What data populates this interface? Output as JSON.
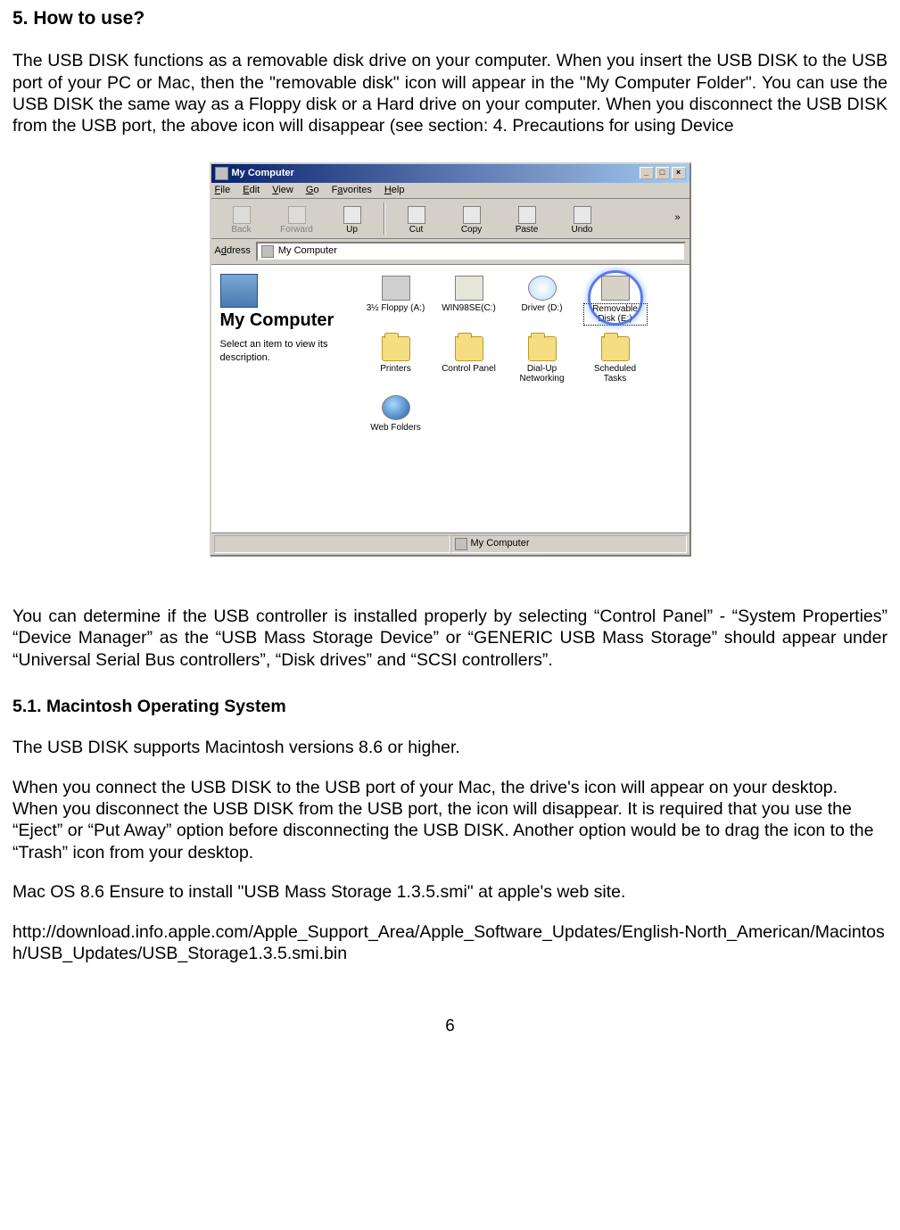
{
  "heading": "5. How to use?",
  "para1": "The USB DISK functions as a removable disk drive on your computer. When you insert the USB DISK to the USB port of your PC or Mac, then the \"removable disk\" icon will appear in the \"My Computer Folder\". You can use the USB DISK the same way as a Floppy disk or a Hard drive on your computer. When you disconnect the USB DISK from the USB port, the above icon will disappear (see section: 4. Precautions for using Device",
  "para2": "You can determine if the USB controller is installed properly by selecting “Control Panel” - “System Properties”   “Device Manager” as the “USB Mass Storage Device” or “GENERIC USB Mass Storage” should appear under “Universal Serial Bus controllers”, “Disk drives” and “SCSI controllers”.",
  "subheading": "5.1.   Macintosh Operating System",
  "mac": {
    "p1": "The USB DISK supports Macintosh versions 8.6 or higher.",
    "p2": "When you connect the USB DISK to the USB port of your Mac, the drive's icon will appear on your desktop. When you disconnect the USB DISK from the USB port, the icon will disappear. It is required that you use the “Eject” or “Put Away” option before disconnecting the USB DISK. Another option would be to drag the icon to the “Trash” icon from your desktop.",
    "p3": "Mac OS 8.6 Ensure to install \"USB Mass Storage 1.3.5.smi\" at apple's web site.",
    "p4": "http://download.info.apple.com/Apple_Support_Area/Apple_Software_Updates/English-North_American/Macintosh/USB_Updates/USB_Storage1.3.5.smi.bin"
  },
  "pagenum": "6",
  "win": {
    "title": "My Computer",
    "ctrls": {
      "min": "_",
      "max": "□",
      "close": "×"
    },
    "menu": [
      "File",
      "Edit",
      "View",
      "Go",
      "Favorites",
      "Help"
    ],
    "toolbar": {
      "back": "Back",
      "forward": "Forward",
      "up": "Up",
      "cut": "Cut",
      "copy": "Copy",
      "paste": "Paste",
      "undo": "Undo",
      "chev": "»"
    },
    "addr_label": "Address",
    "addr_value": "My Computer",
    "left": {
      "title": "My Computer",
      "desc": "Select an item to view its description."
    },
    "items": {
      "floppy": "3½ Floppy (A:)",
      "c": "WIN98SE(C:)",
      "d": "Driver (D:)",
      "e": "Removable Disk (E:)",
      "printers": "Printers",
      "cpanel": "Control Panel",
      "dialup": "Dial-Up Networking",
      "sched": "Scheduled Tasks",
      "webf": "Web Folders"
    },
    "status": "My Computer"
  }
}
